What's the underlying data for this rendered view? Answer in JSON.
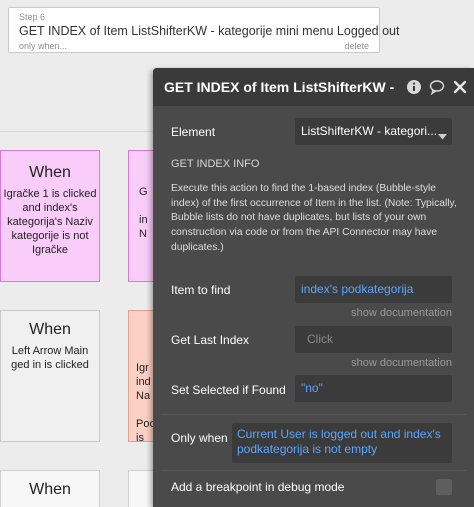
{
  "step_card": {
    "step_label": "Step 6",
    "title": "GET INDEX of Item ListShifterKW - kategorije mini menu Logged out",
    "condition": "only when...",
    "delete_label": "delete"
  },
  "workflow_cards": [
    {
      "when": "When",
      "body": "Igračke 1 is clicked\nand index's\nkategorija's Naziv\nkategorije is not\nIgračke"
    },
    {
      "when": "",
      "body": "G\n\nin\nN"
    },
    {
      "when": "When",
      "body": "Left Arrow Main\nged in is clicked"
    },
    {
      "when": "",
      "body": "Igr\nind\nNa\n\nPoc\nis"
    },
    {
      "when": "When",
      "body": ""
    }
  ],
  "panel": {
    "title": "GET INDEX of Item ListShifterKW -",
    "element_label": "Element",
    "element_value": "ListShifterKW - kategori...",
    "section_header": "GET INDEX INFO",
    "description": "Execute this action to find the 1-based index (Bubble-style index) of the first occurrence of Item in the list. (Note: Typically, Bubble lists do not have duplicates, but lists of your own construction via code or from the API Connector may have duplicates.)",
    "item_to_find_label": "Item to find",
    "item_to_find_value": "index's podkategorija",
    "show_documentation_1": "show documentation",
    "get_last_index_label": "Get Last Index",
    "get_last_index_placeholder": "Click",
    "show_documentation_2": "show documentation",
    "set_selected_label": "Set Selected if Found",
    "set_selected_value": "\"no\"",
    "only_when_label": "Only when",
    "only_when_value": "Current User is logged out and index's podkategorija is not empty",
    "breakpoint_label": "Add a breakpoint in debug mode",
    "icons": [
      "info-icon",
      "comment-icon",
      "close-icon",
      "chevron-down-icon"
    ]
  }
}
